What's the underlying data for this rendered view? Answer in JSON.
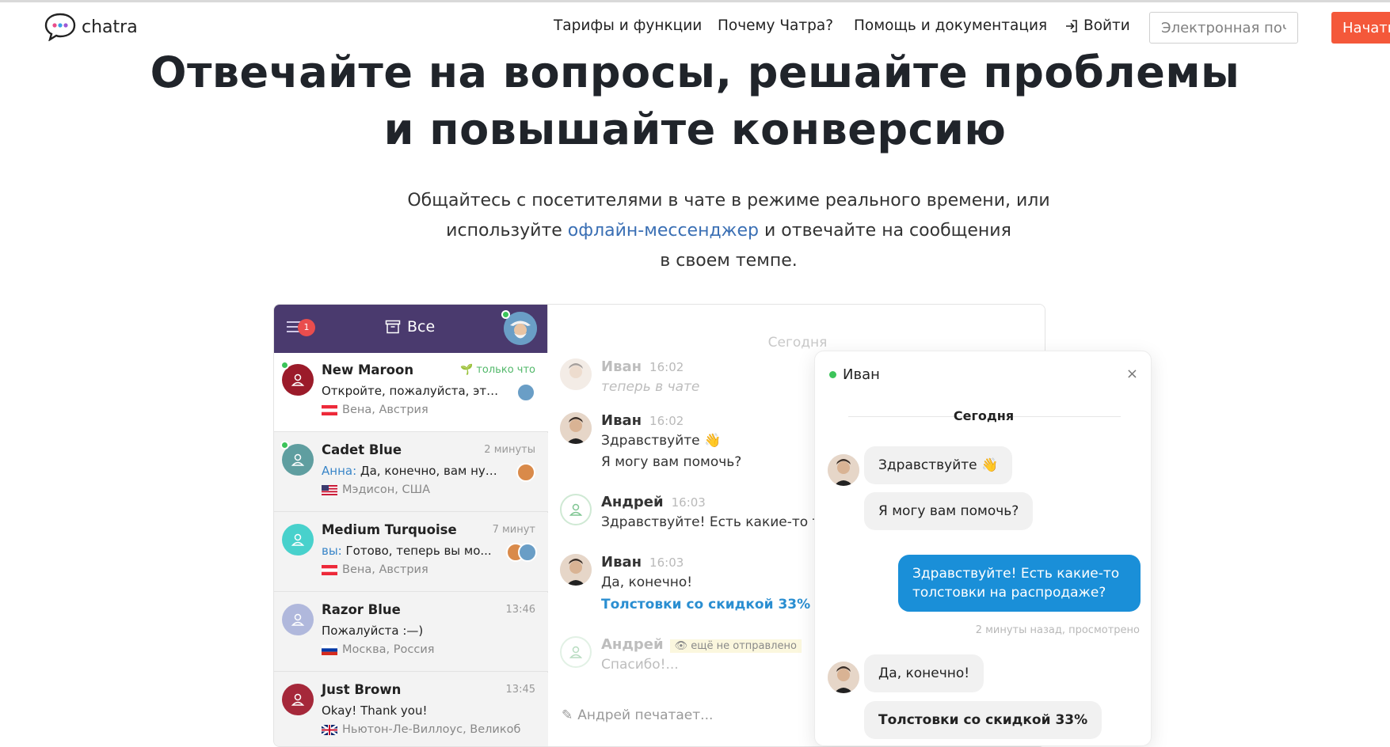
{
  "header": {
    "logo_text": "chatra",
    "nav": [
      {
        "label": "Тарифы и функции"
      },
      {
        "label": "Почему Чатра?"
      },
      {
        "label": "Помощь и документация"
      }
    ],
    "login_label": "Войти",
    "email_placeholder": "Электронная почта",
    "start_label": "Начать"
  },
  "hero": {
    "title_line1": "Отвечайте на вопросы, решайте проблемы",
    "title_line2": "и повышайте конверсию",
    "sub_line1": "Общайтесь с посетителями в чате в режиме реального времени, или",
    "sub_line2_pre": "используйте ",
    "sub_link": "офлайн-мессенджер",
    "sub_line2_post": " и отвечайте на сообщения",
    "sub_line3": "в своем темпе."
  },
  "sidebar": {
    "menu_badge": "1",
    "title": "Все",
    "conversations": [
      {
        "name": "New Maroon",
        "time": "только что",
        "msg_who": "",
        "msg": "Откройте, пожалуйста, эту с...",
        "location": "Вена, Австрия",
        "color": "#9b1b2a"
      },
      {
        "name": "Cadet Blue",
        "time": "2 минуты",
        "msg_who": "Анна: ",
        "msg": "Да, конечно, вам нуж...",
        "location": "Мэдисон, США",
        "color": "#5f9ea0"
      },
      {
        "name": "Medium Turquoise",
        "time": "7 минут",
        "msg_who": "вы: ",
        "msg": "Готово, теперь вы мо...",
        "location": "Вена, Австрия",
        "color": "#48d1cc"
      },
      {
        "name": "Razor Blue",
        "time": "13:46",
        "msg_who": "",
        "msg": "Пожалуйста :—)",
        "location": "Москва, Россия",
        "color": "#b0b8dc"
      },
      {
        "name": "Just Brown",
        "time": "13:45",
        "msg_who": "",
        "msg": "Okay! Thank you!",
        "location": "Ньютон-Ле-Виллоус, Великоб",
        "color": "#a5283a"
      }
    ]
  },
  "chat": {
    "day": "Сегодня",
    "messages": [
      {
        "name": "Иван",
        "time": "16:02",
        "line1": "теперь в чате"
      },
      {
        "name": "Иван",
        "time": "16:02",
        "line1": "Здравствуйте 👋",
        "line2": "Я могу вам помочь?"
      },
      {
        "name": "Андрей",
        "time": "16:03",
        "line1": "Здравствуйте! Есть какие-то то"
      },
      {
        "name": "Иван",
        "time": "16:03",
        "line1": "Да, конечно!",
        "line2": "Толстовки со скидкой 33%"
      },
      {
        "name": "Андрей",
        "status": "ещё не отправлено",
        "line1": "Спасибо!..."
      }
    ],
    "typing": "Андрей печатает..."
  },
  "widget": {
    "name": "Иван",
    "close": "×",
    "day": "Сегодня",
    "bubbles": {
      "b1": "Здравствуйте 👋",
      "b2": "Я могу вам помочь?",
      "b3": "Здравствуйте! Есть какие-то толстовки на распродаже?",
      "meta": "2 минуты назад, просмотрено",
      "b4": "Да, конечно!",
      "b5": "Толстовки со скидкой 33%"
    }
  },
  "colors": {
    "brand_orange": "#f4583a",
    "sidebar_header": "#4a3a6e",
    "out_bubble": "#1a8fd8",
    "link": "#3a6fb4"
  }
}
